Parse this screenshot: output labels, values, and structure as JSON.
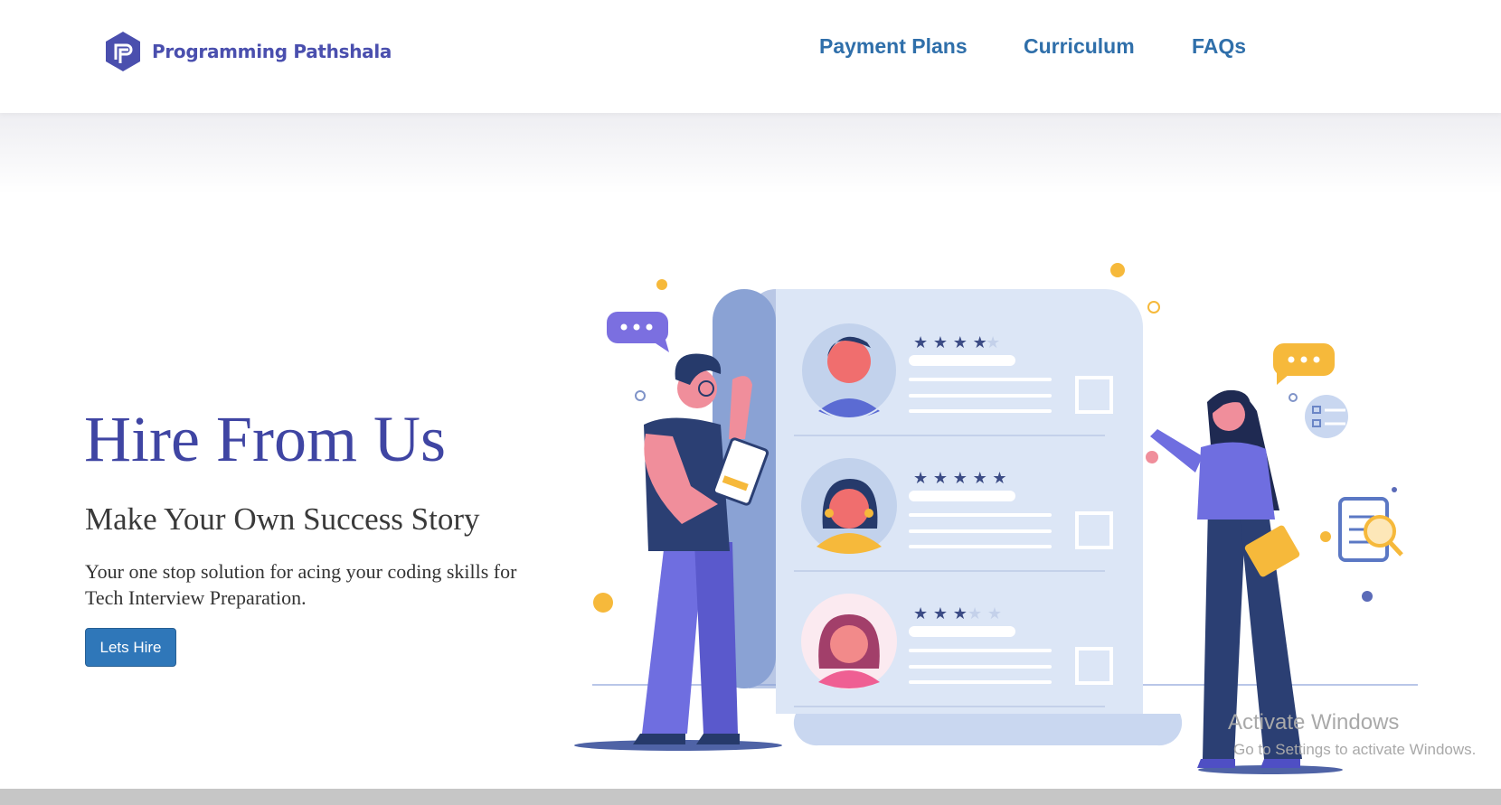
{
  "brand": {
    "name": "Programming Pathshala",
    "logo_icon": "pathshala-logo-icon",
    "color": "#4a4fae"
  },
  "nav": {
    "items": [
      "Payment Plans",
      "Curriculum",
      "FAQs"
    ],
    "color": "#2f6faa"
  },
  "hero": {
    "title": "Hire From Us",
    "subtitle": "Make Your Own Success Story",
    "description": "Your one stop solution for acing your coding skills for Tech Interview Preparation.",
    "cta_label": "Lets Hire",
    "title_color": "#3f45a3",
    "cta_color": "#2f77b9"
  },
  "illustration": {
    "candidates": [
      {
        "rating": 4,
        "max": 5
      },
      {
        "rating": 5,
        "max": 5
      },
      {
        "rating": 3,
        "max": 5
      }
    ],
    "icons": [
      "chat-bubble-icon",
      "chat-bubble-icon",
      "checklist-icon",
      "clipboard-search-icon"
    ]
  },
  "watermark": {
    "line1": "Activate Windows",
    "line2": "Go to Settings to activate Windows."
  }
}
